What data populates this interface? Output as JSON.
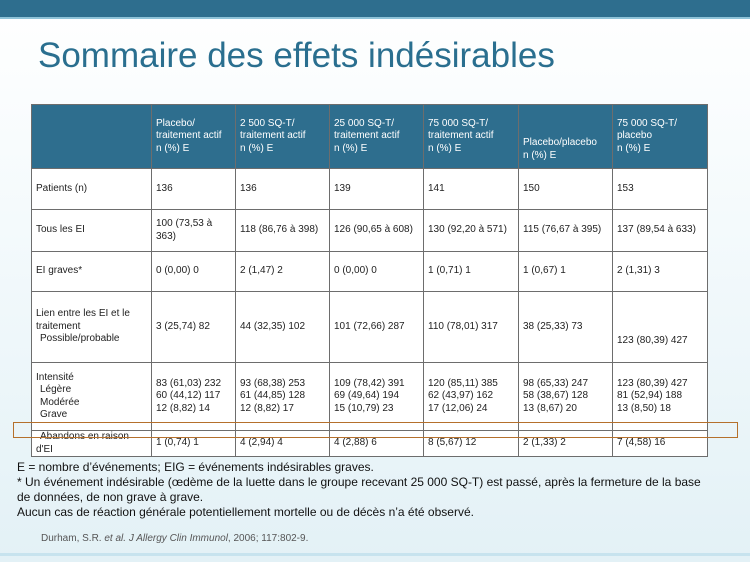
{
  "slide": {
    "title": "Sommaire des effets indésirables"
  },
  "table": {
    "columns": [
      [
        "Placebo/",
        "traitement actif",
        "n (%) E"
      ],
      [
        "2 500 SQ-T/",
        "traitement actif",
        "n (%) E"
      ],
      [
        "25 000 SQ-T/",
        "traitement actif",
        "n (%) E"
      ],
      [
        "75 000 SQ-T/",
        "traitement actif",
        "n (%) E"
      ],
      [
        "Placebo/placebo",
        "n (%) E"
      ],
      [
        "75 000 SQ-T/",
        "placebo",
        "n (%) E"
      ]
    ],
    "rows": {
      "patients": {
        "label": "Patients (n)",
        "values": [
          "136",
          "136",
          "139",
          "141",
          "150",
          "153"
        ]
      },
      "all_ae": {
        "label": "Tous les EI",
        "values": [
          [
            "100 (73,53 à",
            "363)"
          ],
          [
            "118 (86,76 à 398)"
          ],
          [
            "126 (90,65 à 608)"
          ],
          [
            "130 (92,20 à 571)"
          ],
          [
            "115 (76,67 à 395)"
          ],
          [
            "137 (89,54 à 633)"
          ]
        ]
      },
      "serious_ae": {
        "label": "EI graves*",
        "values": [
          "0 (0,00) 0",
          "2 (1,47) 2",
          "0 (0,00) 0",
          "1 (0,71) 1",
          "1 (0,67) 1",
          "2 (1,31) 3"
        ]
      },
      "relation": {
        "label_lines": [
          "Lien entre les EI et le",
          "traitement",
          "  Possible/probable"
        ],
        "values": [
          "3 (25,74) 82",
          "44 (32,35) 102",
          "101 (72,66) 287",
          "110 (78,01) 317",
          "38 (25,33) 73",
          "123 (80,39) 427"
        ]
      },
      "intensity": {
        "label_lines": [
          "Intensité",
          "  Légère",
          "  Modérée",
          "  Grave"
        ],
        "values": [
          [
            "83 (61,03) 232",
            "60 (44,12) 117",
            "12 (8,82) 14"
          ],
          [
            "93 (68,38) 253",
            "61 (44,85) 128",
            "12 (8,82) 17"
          ],
          [
            "109 (78,42) 391",
            "69 (49,64) 194",
            "15 (10,79) 23"
          ],
          [
            "120 (85,11) 385",
            "62 (43,97) 162",
            "17 (12,06) 24"
          ],
          [
            "98 (65,33) 247",
            "58 (38,67) 128",
            "13 (8,67) 20"
          ],
          [
            "123 (80,39) 427",
            "81 (52,94) 188",
            "13 (8,50) 18"
          ]
        ]
      },
      "withdrawal": {
        "label": "  Abandons en raison d'EI",
        "values": [
          "1 (0,74) 1",
          "4 (2,94) 4",
          "4 (2,88) 6",
          "8 (5,67) 12",
          "2 (1,33) 2",
          "7 (4,58) 16"
        ]
      }
    }
  },
  "notes": {
    "line1": "E = nombre d’événements; EIG = événements indésirables graves.",
    "line2": "* Un événement indésirable (œdème de la luette dans le groupe recevant 25 000 SQ-T) est passé, après la fermeture de la base de données, de non grave à grave.",
    "line3": "Aucun cas de réaction générale potentiellement mortelle ou de décès n’a été observé."
  },
  "reference": {
    "authors": "Durham, S.R. ",
    "etal": "et al. J Allergy Clin Immunol",
    "rest": ", 2006; 117:802-9."
  },
  "colors": {
    "header_bg": "#2e6e8e",
    "title_color": "#2a6f8f",
    "highlight_border": "#b5702c"
  }
}
